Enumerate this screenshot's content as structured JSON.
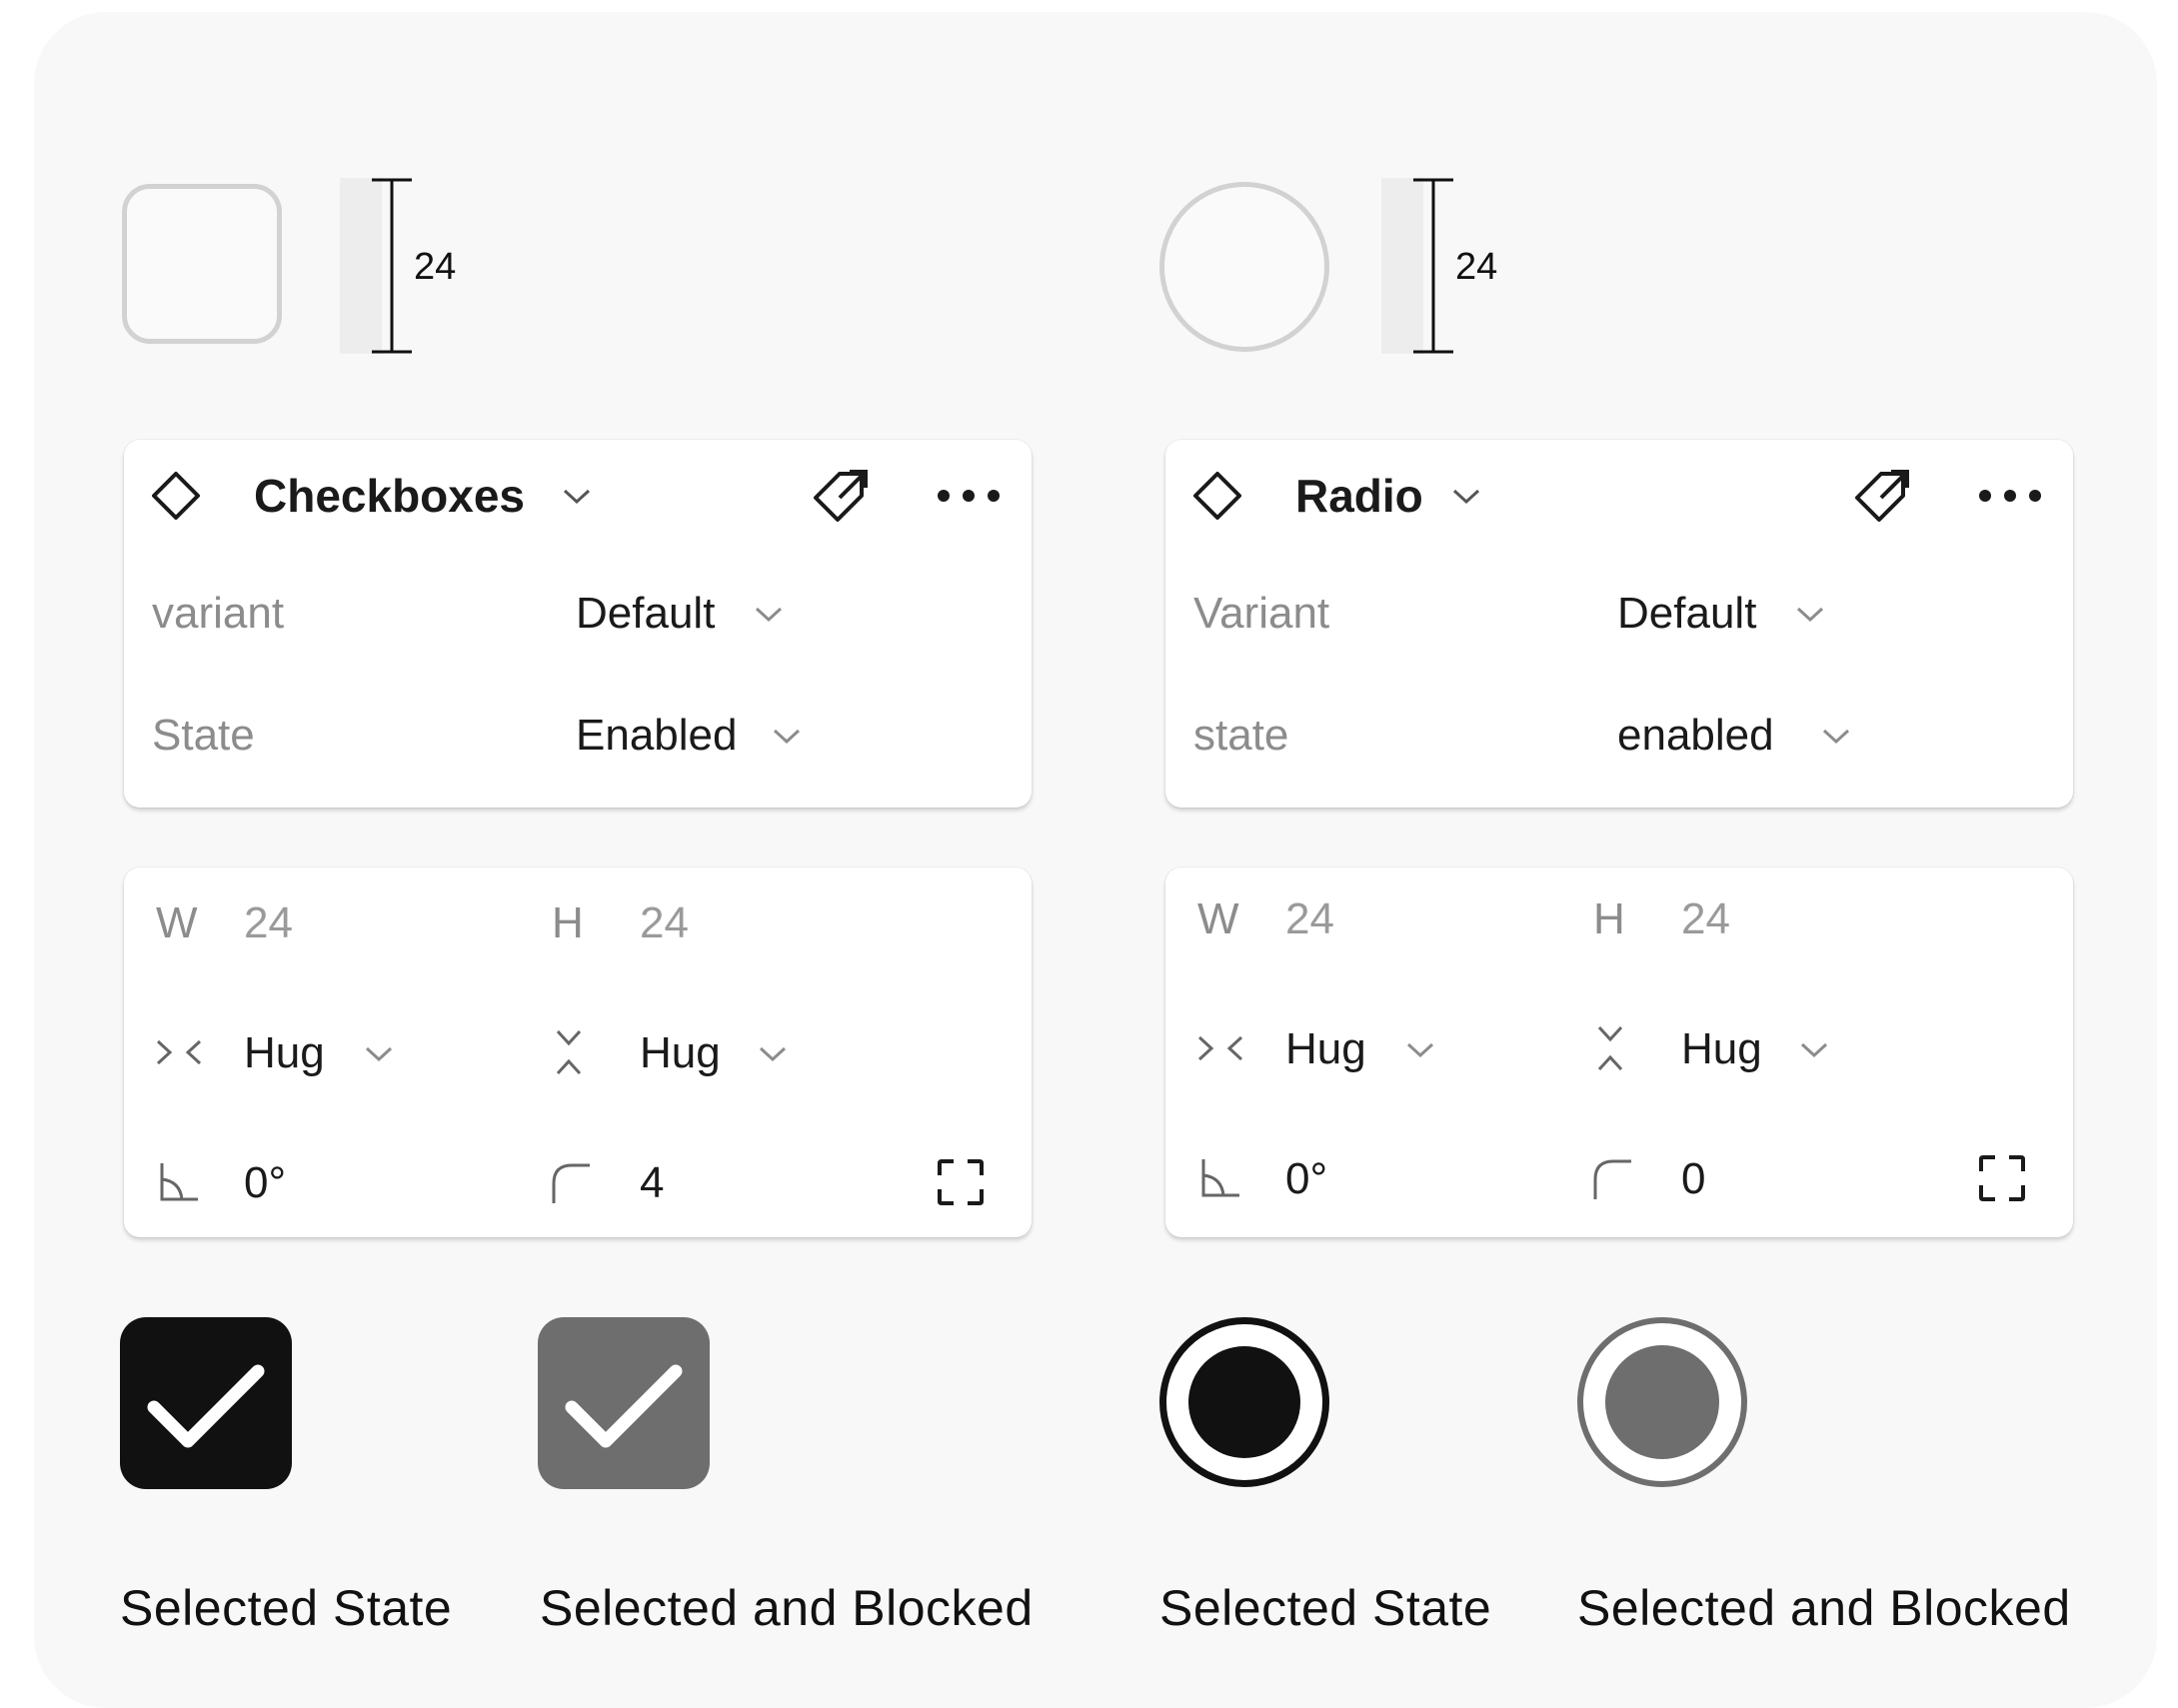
{
  "colors": {
    "background": "#f8f8f8",
    "card": "#ffffff",
    "unselected_border": "#d2d2d2",
    "selected": "#111111",
    "blocked": "#6e6e6e",
    "label_muted": "#8c8c8c"
  },
  "checkbox": {
    "size_label": "24",
    "props_panel": {
      "title": "Checkboxes",
      "icons": [
        "component-diamond-icon",
        "chevron-down-icon",
        "go-to-main-component-icon",
        "more-horizontal-icon"
      ],
      "rows": [
        {
          "label": "variant",
          "value": "Default"
        },
        {
          "label": "State",
          "value": "Enabled"
        }
      ]
    },
    "size_panel": {
      "w_label": "W",
      "w_value": "24",
      "h_label": "H",
      "h_value": "24",
      "hug_w": "Hug",
      "hug_h": "Hug",
      "rotation": "0°",
      "radius": "4"
    },
    "states": [
      {
        "caption": "Selected State",
        "checked": true
      },
      {
        "caption": "Selected and Blocked",
        "checked": true
      }
    ]
  },
  "radio": {
    "size_label": "24",
    "props_panel": {
      "title": "Radio",
      "icons": [
        "component-diamond-icon",
        "chevron-down-icon",
        "go-to-main-component-icon",
        "more-horizontal-icon"
      ],
      "rows": [
        {
          "label": "Variant",
          "value": "Default"
        },
        {
          "label": "state",
          "value": "enabled"
        }
      ]
    },
    "size_panel": {
      "w_label": "W",
      "w_value": "24",
      "h_label": "H",
      "h_value": "24",
      "hug_w": "Hug",
      "hug_h": "Hug",
      "rotation": "0°",
      "radius": "0"
    },
    "states": [
      {
        "caption": "Selected State",
        "checked": true
      },
      {
        "caption": "Selected and Blocked",
        "checked": true
      }
    ]
  }
}
